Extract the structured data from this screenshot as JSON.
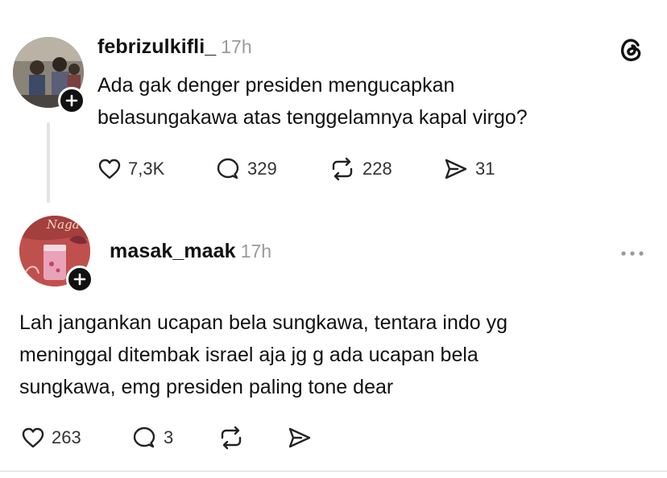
{
  "post": {
    "username": "febrizulkifli_",
    "time": "17h",
    "text_line1": "Ada gak denger presiden mengucapkan",
    "text_line2": "belasungakawa atas tenggelamnya kapal virgo?",
    "likes": "7,3K",
    "replies": "329",
    "reposts": "228",
    "shares": "31"
  },
  "reply": {
    "username": "masak_maak",
    "time": "17h",
    "avatar_text": "Naga",
    "text_line1": "Lah jangankan ucapan bela sungkawa, tentara indo yg",
    "text_line2": "meninggal ditembak israel aja jg g ada ucapan bela",
    "text_line3": "sungkawa, emg presiden paling tone dear",
    "likes": "263",
    "replies": "3"
  },
  "icons": {
    "app": "threads-logo-icon",
    "like": "heart-icon",
    "reply": "comment-bubble-icon",
    "repost": "repost-icon",
    "share": "send-icon",
    "more": "more-dots-icon"
  }
}
